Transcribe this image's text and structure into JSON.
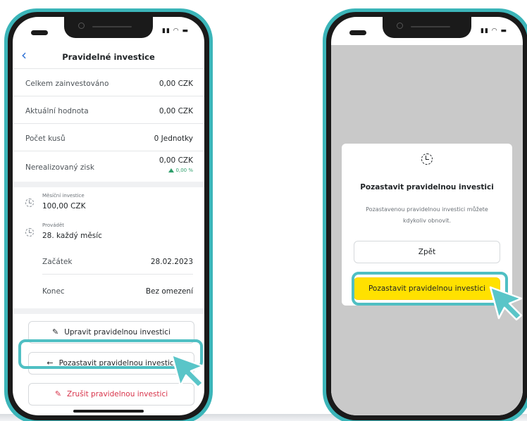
{
  "left_phone": {
    "header": {
      "back_icon": "chevron-left-icon",
      "title": "Pravidelné investice"
    },
    "summary": [
      {
        "label": "Celkem zainvestováno",
        "value": "0,00 CZK"
      },
      {
        "label": "Aktuální hodnota",
        "value": "0,00 CZK"
      },
      {
        "label": "Počet kusů",
        "value": "0 Jednotky"
      },
      {
        "label": "Nerealizovaný zisk",
        "value": "0,00 CZK",
        "change": "0,00 %"
      }
    ],
    "monthly": {
      "label": "Měsíční investice",
      "value": "100,00 CZK"
    },
    "execute": {
      "label": "Provádět",
      "value": "28. každý měsíc"
    },
    "start": {
      "label": "Začátek",
      "value": "28.02.2023"
    },
    "end": {
      "label": "Konec",
      "value": "Bez omezení"
    },
    "buttons": {
      "edit": "Upravit pravidelnou investici",
      "pause": "Pozastavit pravidelnou investici",
      "cancel": "Zrušit pravidelnou investici"
    }
  },
  "right_phone": {
    "modal": {
      "icon": "clock-pause-icon",
      "title": "Pozastavit pravidelnou investici",
      "description": "Pozastavenou pravidelnou investici můžete kdykoliv obnovit.",
      "back_button": "Zpět",
      "confirm_button": "Pozastavit pravidelnou investici"
    }
  },
  "colors": {
    "highlight": "#4fbfc3",
    "frame_accent": "#3bb5b9",
    "confirm_yellow": "#ffe100",
    "danger_red": "#d8334a",
    "gain_green": "#2e9e6b",
    "link_blue": "#2b6fd4"
  }
}
